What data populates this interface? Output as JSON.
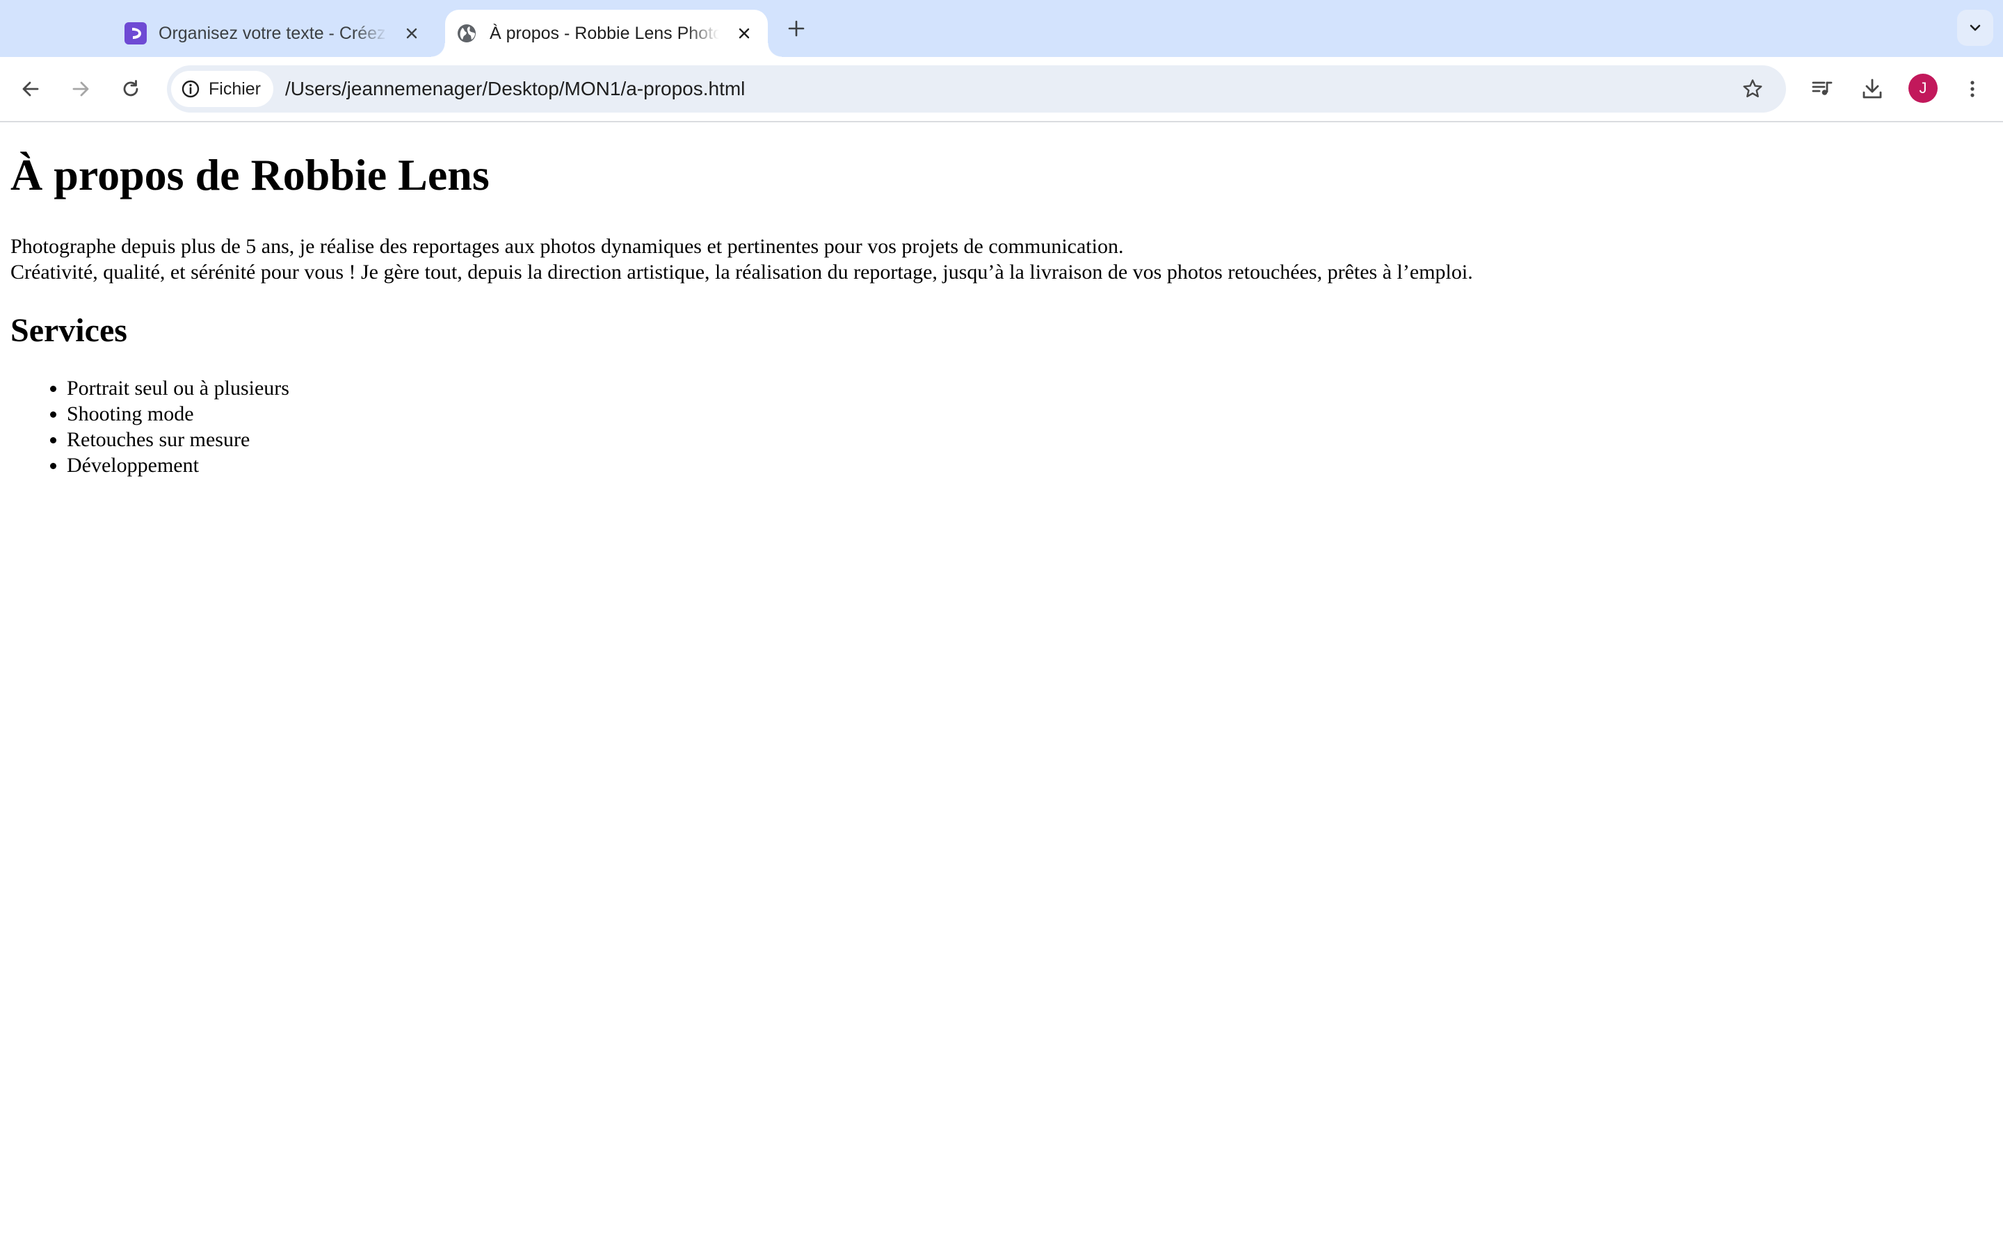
{
  "browser": {
    "tabs": [
      {
        "title": "Organisez votre texte - Créez des titres",
        "favicon": "openclassrooms-icon",
        "active": false
      },
      {
        "title": "À propos - Robbie Lens Photographie",
        "favicon": "globe-icon",
        "active": true
      }
    ],
    "security_chip": "Fichier",
    "url": "/Users/jeannemenager/Desktop/MON1/a-propos.html",
    "profile_initial": "J",
    "colors": {
      "tabstrip": "#d3e3fd",
      "omnibox": "#e9eef6",
      "avatar": "#c2185b",
      "favicon_purple": "#6e4ad4"
    }
  },
  "page": {
    "title": "À propos de Robbie Lens",
    "paragraph_lines": [
      "Photographe depuis plus de 5 ans, je réalise des reportages aux photos dynamiques et pertinentes pour vos projets de communication.",
      "Créativité, qualité, et sérénité pour vous ! Je gère tout, depuis la direction artistique, la réalisation du reportage, jusqu’à la livraison de vos photos retouchées, prêtes à l’emploi."
    ],
    "services_heading": "Services",
    "services": [
      "Portrait seul ou à plusieurs",
      "Shooting mode",
      "Retouches sur mesure",
      "Développement"
    ]
  }
}
